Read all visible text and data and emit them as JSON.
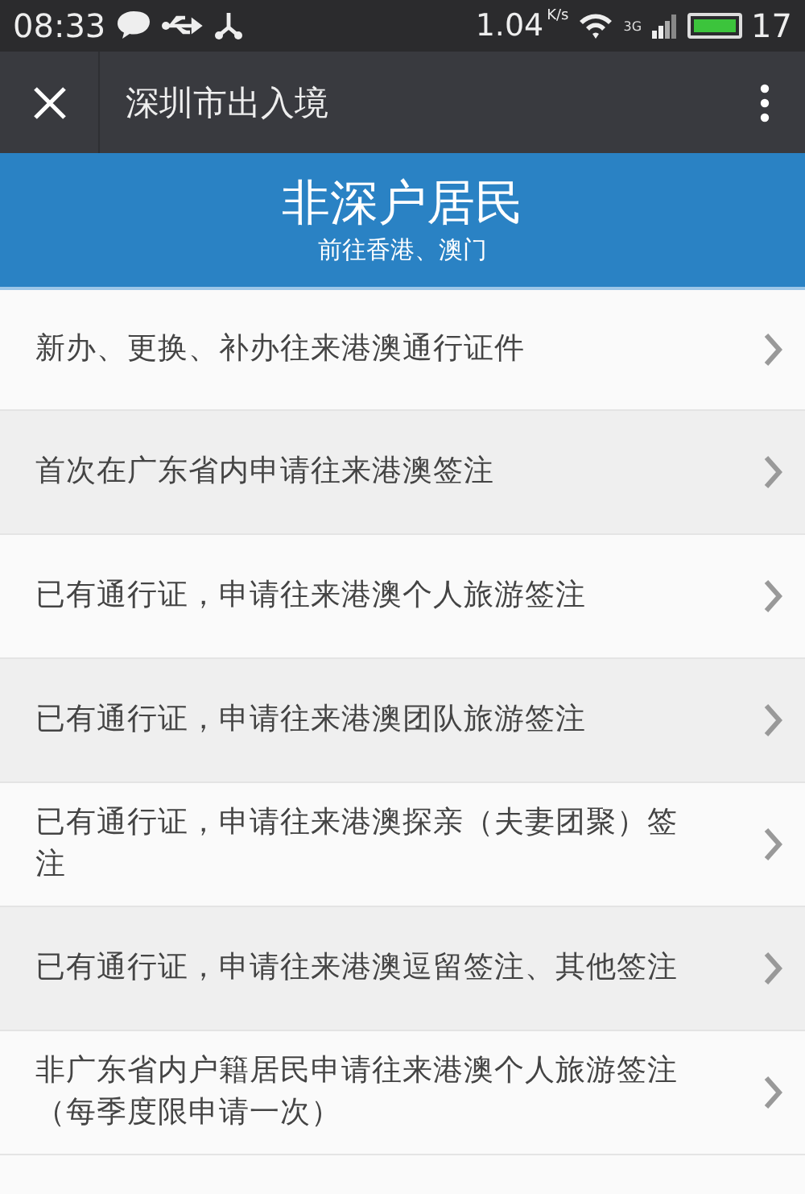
{
  "status_bar": {
    "time": "08:33",
    "speed": "1.04",
    "speed_unit": "K/s",
    "network": "3G",
    "battery": "17"
  },
  "toolbar": {
    "title": "深圳市出入境"
  },
  "banner": {
    "title": "非深户居民",
    "subtitle": "前往香港、澳门"
  },
  "items": [
    {
      "label": "新办、更换、补办往来港澳通行证件"
    },
    {
      "label": "首次在广东省内申请往来港澳签注"
    },
    {
      "label": "已有通行证，申请往来港澳个人旅游签注"
    },
    {
      "label": "已有通行证，申请往来港澳团队旅游签注"
    },
    {
      "label": "已有通行证，申请往来港澳探亲（夫妻团聚）签注"
    },
    {
      "label": "已有通行证，申请往来港澳逗留签注、其他签注"
    },
    {
      "label": "非广东省内户籍居民申请往来港澳个人旅游签注（每季度限申请一次）"
    }
  ]
}
